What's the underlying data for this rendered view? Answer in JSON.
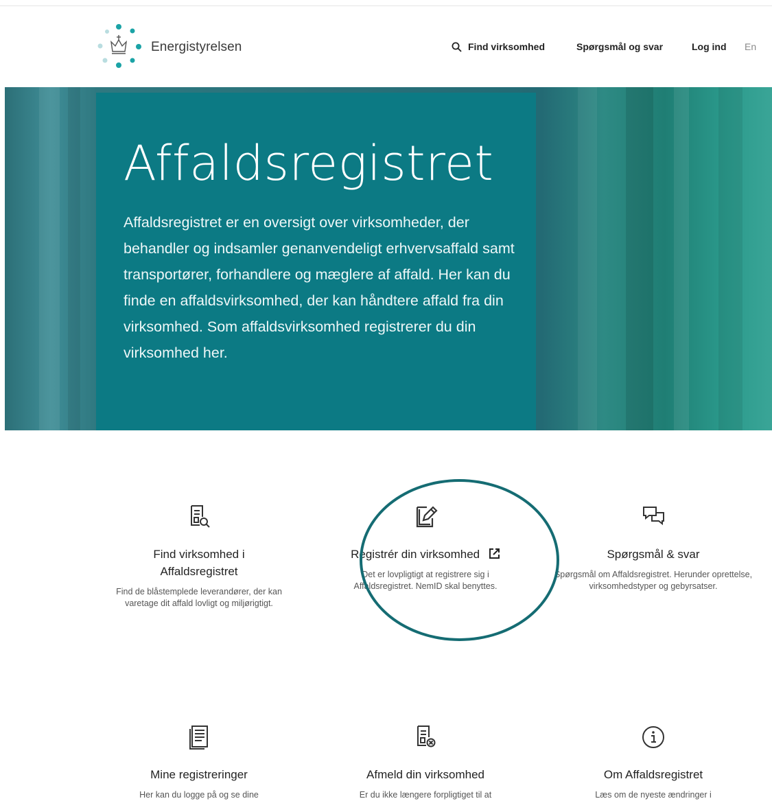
{
  "header": {
    "logo_text": "Energistyrelsen",
    "nav": {
      "find": "Find virksomhed",
      "faq": "Spørgsmål og svar",
      "login": "Log ind",
      "lang": "En"
    }
  },
  "hero": {
    "title": "Affaldsregistret",
    "text": "Affaldsregistret er en oversigt over virksomheder, der behandler og indsamler genanvendeligt erhvervsaffald samt transportører, forhandlere og mæglere af affald. Her kan du finde en affaldsvirksomhed, der kan håndtere affald fra din virksomhed. Som affaldsvirksomhed registrerer du din virksomhed her."
  },
  "cards": [
    {
      "icon": "document-search-icon",
      "title": "Find virksomhed i Affaldsregistret",
      "desc": "Find de blåstemplede leverandører, der kan varetage dit affald lovligt og miljørigtigt."
    },
    {
      "icon": "edit-document-icon",
      "title": "Registrér din virksomhed",
      "desc": "Det er lovpligtigt at registrere sig i Affaldsregistret. NemID skal benyttes."
    },
    {
      "icon": "chat-bubbles-icon",
      "title": "Spørgsmål & svar",
      "desc": "Spørgsmål om Affaldsregistret. Herunder oprettelse, virksomhedstyper og gebyrsatser."
    },
    {
      "icon": "document-list-icon",
      "title": "Mine registreringer",
      "desc": "Her kan du logge på og se dine"
    },
    {
      "icon": "document-remove-icon",
      "title": "Afmeld din virksomhed",
      "desc": "Er du ikke længere forpligtiget til at"
    },
    {
      "icon": "info-icon",
      "title": "Om Affaldsregistret",
      "desc": "Læs om de nyeste ændringer i"
    }
  ],
  "colors": {
    "brand_teal": "#0c7a84",
    "logo_teal": "#1ba3a6",
    "annotation_circle": "#156c73"
  }
}
